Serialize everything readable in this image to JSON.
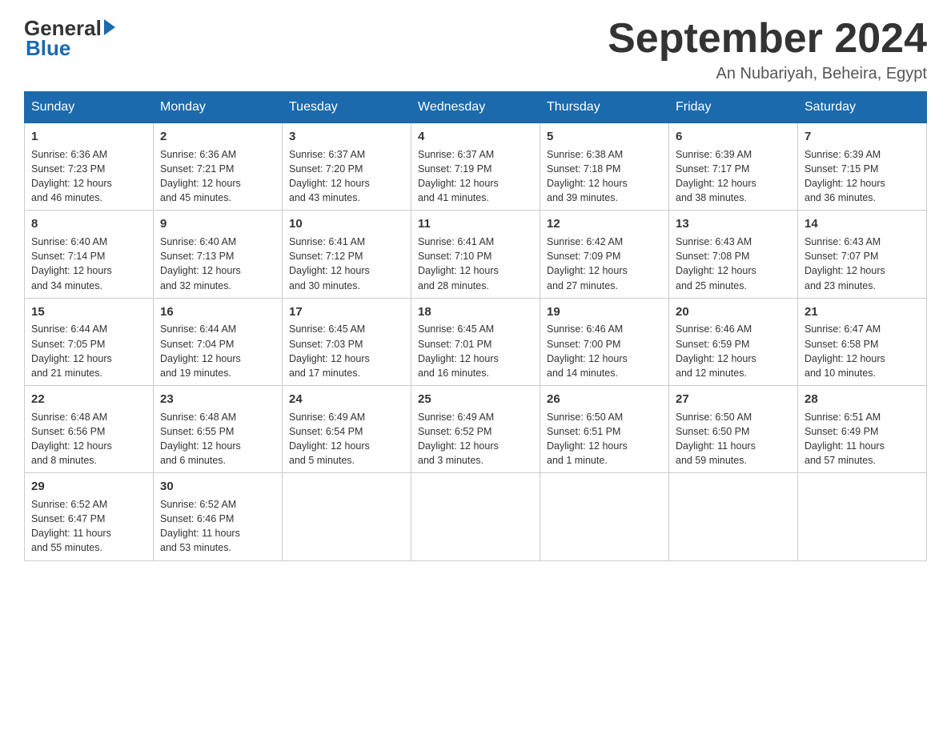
{
  "header": {
    "logo_general": "General",
    "logo_blue": "Blue",
    "month_title": "September 2024",
    "location": "An Nubariyah, Beheira, Egypt"
  },
  "days_of_week": [
    "Sunday",
    "Monday",
    "Tuesday",
    "Wednesday",
    "Thursday",
    "Friday",
    "Saturday"
  ],
  "weeks": [
    [
      {
        "day": "1",
        "sunrise": "6:36 AM",
        "sunset": "7:23 PM",
        "daylight": "12 hours and 46 minutes."
      },
      {
        "day": "2",
        "sunrise": "6:36 AM",
        "sunset": "7:21 PM",
        "daylight": "12 hours and 45 minutes."
      },
      {
        "day": "3",
        "sunrise": "6:37 AM",
        "sunset": "7:20 PM",
        "daylight": "12 hours and 43 minutes."
      },
      {
        "day": "4",
        "sunrise": "6:37 AM",
        "sunset": "7:19 PM",
        "daylight": "12 hours and 41 minutes."
      },
      {
        "day": "5",
        "sunrise": "6:38 AM",
        "sunset": "7:18 PM",
        "daylight": "12 hours and 39 minutes."
      },
      {
        "day": "6",
        "sunrise": "6:39 AM",
        "sunset": "7:17 PM",
        "daylight": "12 hours and 38 minutes."
      },
      {
        "day": "7",
        "sunrise": "6:39 AM",
        "sunset": "7:15 PM",
        "daylight": "12 hours and 36 minutes."
      }
    ],
    [
      {
        "day": "8",
        "sunrise": "6:40 AM",
        "sunset": "7:14 PM",
        "daylight": "12 hours and 34 minutes."
      },
      {
        "day": "9",
        "sunrise": "6:40 AM",
        "sunset": "7:13 PM",
        "daylight": "12 hours and 32 minutes."
      },
      {
        "day": "10",
        "sunrise": "6:41 AM",
        "sunset": "7:12 PM",
        "daylight": "12 hours and 30 minutes."
      },
      {
        "day": "11",
        "sunrise": "6:41 AM",
        "sunset": "7:10 PM",
        "daylight": "12 hours and 28 minutes."
      },
      {
        "day": "12",
        "sunrise": "6:42 AM",
        "sunset": "7:09 PM",
        "daylight": "12 hours and 27 minutes."
      },
      {
        "day": "13",
        "sunrise": "6:43 AM",
        "sunset": "7:08 PM",
        "daylight": "12 hours and 25 minutes."
      },
      {
        "day": "14",
        "sunrise": "6:43 AM",
        "sunset": "7:07 PM",
        "daylight": "12 hours and 23 minutes."
      }
    ],
    [
      {
        "day": "15",
        "sunrise": "6:44 AM",
        "sunset": "7:05 PM",
        "daylight": "12 hours and 21 minutes."
      },
      {
        "day": "16",
        "sunrise": "6:44 AM",
        "sunset": "7:04 PM",
        "daylight": "12 hours and 19 minutes."
      },
      {
        "day": "17",
        "sunrise": "6:45 AM",
        "sunset": "7:03 PM",
        "daylight": "12 hours and 17 minutes."
      },
      {
        "day": "18",
        "sunrise": "6:45 AM",
        "sunset": "7:01 PM",
        "daylight": "12 hours and 16 minutes."
      },
      {
        "day": "19",
        "sunrise": "6:46 AM",
        "sunset": "7:00 PM",
        "daylight": "12 hours and 14 minutes."
      },
      {
        "day": "20",
        "sunrise": "6:46 AM",
        "sunset": "6:59 PM",
        "daylight": "12 hours and 12 minutes."
      },
      {
        "day": "21",
        "sunrise": "6:47 AM",
        "sunset": "6:58 PM",
        "daylight": "12 hours and 10 minutes."
      }
    ],
    [
      {
        "day": "22",
        "sunrise": "6:48 AM",
        "sunset": "6:56 PM",
        "daylight": "12 hours and 8 minutes."
      },
      {
        "day": "23",
        "sunrise": "6:48 AM",
        "sunset": "6:55 PM",
        "daylight": "12 hours and 6 minutes."
      },
      {
        "day": "24",
        "sunrise": "6:49 AM",
        "sunset": "6:54 PM",
        "daylight": "12 hours and 5 minutes."
      },
      {
        "day": "25",
        "sunrise": "6:49 AM",
        "sunset": "6:52 PM",
        "daylight": "12 hours and 3 minutes."
      },
      {
        "day": "26",
        "sunrise": "6:50 AM",
        "sunset": "6:51 PM",
        "daylight": "12 hours and 1 minute."
      },
      {
        "day": "27",
        "sunrise": "6:50 AM",
        "sunset": "6:50 PM",
        "daylight": "11 hours and 59 minutes."
      },
      {
        "day": "28",
        "sunrise": "6:51 AM",
        "sunset": "6:49 PM",
        "daylight": "11 hours and 57 minutes."
      }
    ],
    [
      {
        "day": "29",
        "sunrise": "6:52 AM",
        "sunset": "6:47 PM",
        "daylight": "11 hours and 55 minutes."
      },
      {
        "day": "30",
        "sunrise": "6:52 AM",
        "sunset": "6:46 PM",
        "daylight": "11 hours and 53 minutes."
      },
      null,
      null,
      null,
      null,
      null
    ]
  ]
}
